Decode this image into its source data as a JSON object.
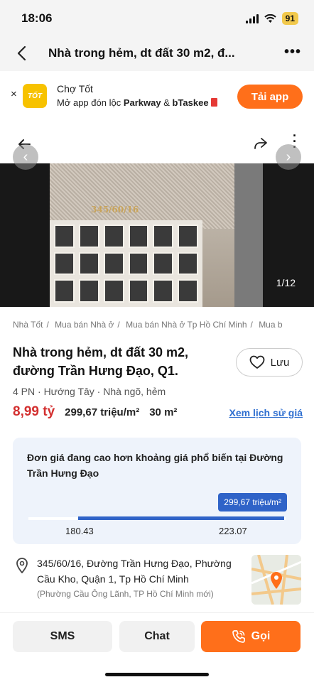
{
  "status_bar": {
    "time": "18:06",
    "battery": "91"
  },
  "nav": {
    "title": "Nhà trong hẻm, dt đất 30 m2, đ...",
    "more": "•••"
  },
  "app_banner": {
    "close": "×",
    "logo_text": "TỐT",
    "title": "Chợ Tốt",
    "subtitle_prefix": "Mở app đón lộc ",
    "subtitle_bold_1": "Parkway",
    "subtitle_mid": " & ",
    "subtitle_bold_2": "bTaskee",
    "button": "Tải app"
  },
  "photo": {
    "counter": "1/12",
    "sign_text": "345/60/16"
  },
  "breadcrumb": [
    "Nhà Tốt",
    "Mua bán Nhà ở",
    "Mua bán Nhà ở Tp Hồ Chí Minh",
    "Mua b"
  ],
  "listing": {
    "title": "Nhà trong hẻm, dt đất 30 m2, đường Trần Hưng Đạo, Q1.",
    "save_label": "Lưu",
    "specs": "4 PN · Hướng Tây · Nhà ngõ, hẻm",
    "price": "8,99 tỷ",
    "price_per_m2": "299,67 triệu/m²",
    "area": "30 m²",
    "history_link": "Xem lịch sử giá"
  },
  "price_card": {
    "message": "Đơn giá đang cao hơn khoảng giá phổ biến tại Đường Trần Hưng Đạo",
    "current": "299,67 triệu/m²",
    "range_low": "180.43",
    "range_high": "223.07"
  },
  "address": {
    "line": "345/60/16, Đường Trần Hưng Đạo, Phường Cầu Kho, Quận 1, Tp Hồ Chí Minh",
    "new_name": "(Phường Cầu Ông Lãnh, TP Hồ Chí Minh mới)"
  },
  "actions": {
    "sms": "SMS",
    "chat": "Chat",
    "call": "Gọi"
  },
  "colors": {
    "accent": "#ff6f1a",
    "price": "#d32f2f",
    "link": "#2f6fd0",
    "card": "#eef3fb",
    "bar": "#2f63c8"
  }
}
